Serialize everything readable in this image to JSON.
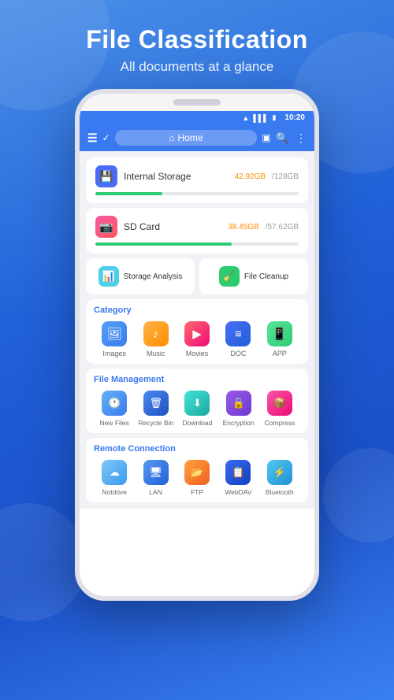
{
  "header": {
    "title": "File Classification",
    "subtitle": "All documents at a glance"
  },
  "status_bar": {
    "time": "10:20",
    "icons": [
      "wifi",
      "signal",
      "battery"
    ]
  },
  "app_bar": {
    "home_label": "Home",
    "search_label": "Search",
    "more_label": "More"
  },
  "storage": {
    "internal": {
      "name": "Internal Storage",
      "used": "42.92GB",
      "total": "128GB",
      "progress": 33
    },
    "sd": {
      "name": "SD Card",
      "used": "38.45GB",
      "total": "57.62GB",
      "progress": 67
    }
  },
  "quick_actions": [
    {
      "label": "Storage Analysis",
      "icon": "📊"
    },
    {
      "label": "File Cleanup",
      "icon": "🧹"
    }
  ],
  "category": {
    "title": "Category",
    "items": [
      {
        "label": "Images",
        "icon": "🖼"
      },
      {
        "label": "Music",
        "icon": "♪"
      },
      {
        "label": "Movies",
        "icon": "▶"
      },
      {
        "label": "DOC",
        "icon": "≡"
      },
      {
        "label": "APP",
        "icon": "📱"
      }
    ]
  },
  "file_management": {
    "title": "File Management",
    "items": [
      {
        "label": "New Files",
        "icon": "🕐"
      },
      {
        "label": "Recycle Bin",
        "icon": "🗑"
      },
      {
        "label": "Download",
        "icon": "⬇"
      },
      {
        "label": "Encryption",
        "icon": "🔒"
      },
      {
        "label": "Compress",
        "icon": "📦"
      }
    ]
  },
  "remote_connection": {
    "title": "Remote Connection",
    "items": [
      {
        "label": "Notdrive",
        "icon": "☁"
      },
      {
        "label": "LAN",
        "icon": "🖥"
      },
      {
        "label": "FTP",
        "icon": "📂"
      },
      {
        "label": "WebDAV",
        "icon": "📋"
      },
      {
        "label": "Bluetooth",
        "icon": "⚡"
      }
    ]
  }
}
